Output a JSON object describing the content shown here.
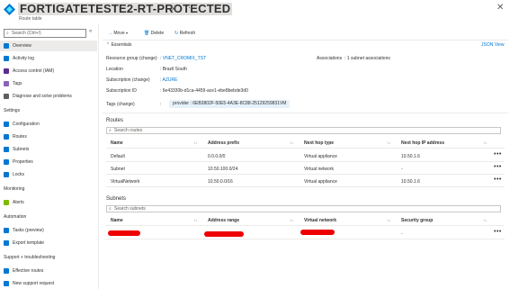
{
  "header": {
    "title": "FORTIGATETESTE2-RT-PROTECTED",
    "subtitle": "Route table",
    "pin_icon": "pin-icon",
    "more_icon": "more-icon",
    "close_icon": "close-icon"
  },
  "sidebar": {
    "search_placeholder": "Search (Ctrl+/)",
    "collapse": "«",
    "items_top": [
      {
        "label": "Overview",
        "icon": "overview-icon",
        "color": "#0078d4"
      },
      {
        "label": "Activity log",
        "icon": "activity-log-icon",
        "color": "#0078d4"
      },
      {
        "label": "Access control (IAM)",
        "icon": "iam-icon",
        "color": "#5c2d91"
      },
      {
        "label": "Tags",
        "icon": "tag-icon",
        "color": "#8764b8"
      },
      {
        "label": "Diagnose and solve problems",
        "icon": "wrench-icon",
        "color": "#605e5c"
      }
    ],
    "section_settings": "Settings",
    "items_settings": [
      {
        "label": "Configuration",
        "icon": "configuration-icon",
        "color": "#0078d4"
      },
      {
        "label": "Routes",
        "icon": "routes-icon",
        "color": "#0078d4"
      },
      {
        "label": "Subnets",
        "icon": "subnets-icon",
        "color": "#0078d4"
      },
      {
        "label": "Properties",
        "icon": "properties-icon",
        "color": "#0078d4"
      },
      {
        "label": "Locks",
        "icon": "lock-icon",
        "color": "#0078d4"
      }
    ],
    "section_monitoring": "Monitoring",
    "items_monitoring": [
      {
        "label": "Alerts",
        "icon": "alerts-icon",
        "color": "#7fba00"
      }
    ],
    "section_automation": "Automation",
    "items_automation": [
      {
        "label": "Tasks (preview)",
        "icon": "tasks-icon",
        "color": "#0078d4"
      },
      {
        "label": "Export template",
        "icon": "export-icon",
        "color": "#0078d4"
      }
    ],
    "section_support": "Support + troubleshooting",
    "items_support": [
      {
        "label": "Effective routes",
        "icon": "effective-routes-icon",
        "color": "#0078d4"
      },
      {
        "label": "New support request",
        "icon": "support-icon",
        "color": "#0078d4"
      }
    ]
  },
  "toolbar": {
    "move": "Move",
    "delete": "Delete",
    "refresh": "Refresh"
  },
  "essentials": {
    "title": "Essentials",
    "json_view": "JSON View",
    "resource_group_label": "Resource group (change)",
    "resource_group_value": "VNET_CROMIX_TST",
    "location_label": "Location",
    "location_value": "Brazil South",
    "subscription_label": "Subscription (change)",
    "subscription_value": "AZURE",
    "subscription_id_label": "Subscription ID",
    "subscription_id_value": "6e43330b-d1ca-4459-ace1-ebe8bebde3d0",
    "tags_label": "Tags (change)",
    "tags_value": "provider : 6EB3802F-50E5-4A3E-8C88-25129259831VM",
    "associations_label": "Associations",
    "associations_value": "1 subnet associations"
  },
  "routes": {
    "title": "Routes",
    "search_placeholder": "Search routes",
    "columns": [
      "Name",
      "Address prefix",
      "Next hop type",
      "Next hop IP address"
    ],
    "rows": [
      [
        "Default",
        "0.0.0.0/0",
        "Virtual appliance",
        "10.50.1.6"
      ],
      [
        "Subnet",
        "10.50.100.0/24",
        "Virtual network",
        "-"
      ],
      [
        "VirtualNetwork",
        "10.50.0.0/16",
        "Virtual appliance",
        "10.50.1.6"
      ]
    ],
    "more": "•••"
  },
  "subnets": {
    "title": "Subnets",
    "search_placeholder": "Search subnets",
    "columns": [
      "Name",
      "Address range",
      "Virtual network",
      "Security group"
    ],
    "row_security_group": "-",
    "more": "•••"
  }
}
